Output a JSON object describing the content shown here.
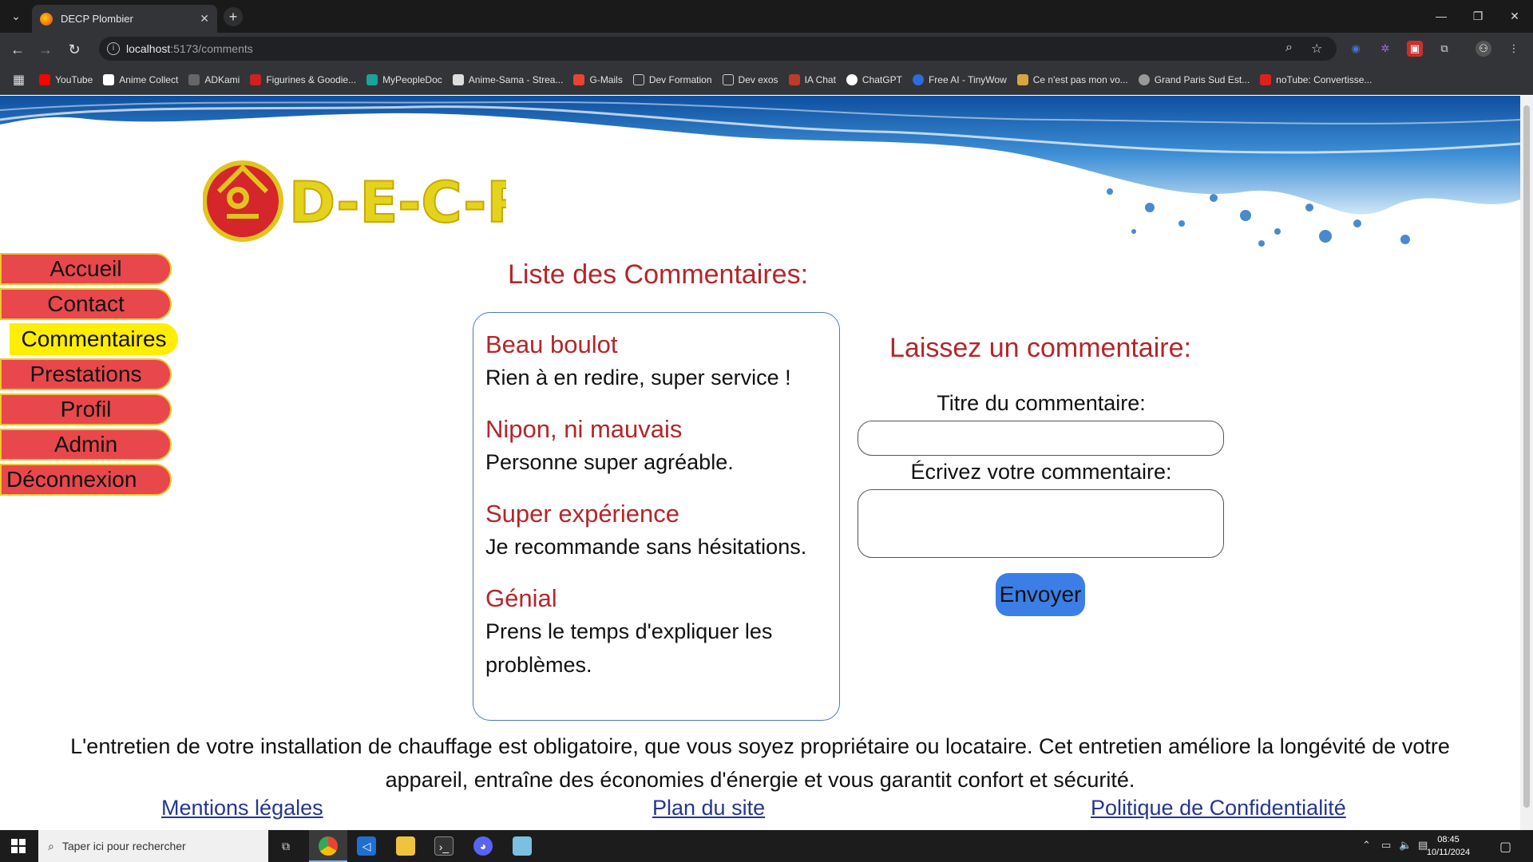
{
  "browser": {
    "tab_title": "DECP Plombier",
    "tab_close": "✕",
    "new_tab": "+",
    "url_host": "localhost",
    "url_path": ":5173/comments",
    "bookmarks": [
      {
        "label": "YouTube",
        "color": "#ff0000"
      },
      {
        "label": "Anime Collect",
        "color": "#ffffff"
      },
      {
        "label": "ADKami",
        "color": "#666666"
      },
      {
        "label": "Figurines & Goodie...",
        "color": "#d02020"
      },
      {
        "label": "MyPeopleDoc",
        "color": "#1aa39a"
      },
      {
        "label": "Anime-Sama - Strea...",
        "color": "#dddddd"
      },
      {
        "label": "G-Mails",
        "color": "#ea4335"
      },
      {
        "label": "Dev Formation",
        "color": "#888888"
      },
      {
        "label": "Dev exos",
        "color": "#888888"
      },
      {
        "label": "IA Chat",
        "color": "#c03a2b"
      },
      {
        "label": "ChatGPT",
        "color": "#ffffff"
      },
      {
        "label": "Free AI - TinyWow",
        "color": "#2d6cdf"
      },
      {
        "label": "Ce n'est pas mon vo...",
        "color": "#d9a441"
      },
      {
        "label": "Grand Paris Sud Est...",
        "color": "#999999"
      },
      {
        "label": "noTube: Convertisse...",
        "color": "#e02020"
      }
    ]
  },
  "site": {
    "logo_text": "D-E-C-P",
    "menu": [
      {
        "label": "Accueil",
        "active": false
      },
      {
        "label": "Contact",
        "active": false
      },
      {
        "label": "Commentaires",
        "active": true
      },
      {
        "label": "Prestations",
        "active": false
      },
      {
        "label": "Profil",
        "active": false
      },
      {
        "label": "Admin",
        "active": false
      },
      {
        "label": "Déconnexion",
        "active": false
      }
    ],
    "list_title": "Liste des Commentaires:",
    "comments": [
      {
        "title": "Beau boulot",
        "body": "Rien à en redire, super service !"
      },
      {
        "title": "Nipon, ni mauvais",
        "body": "Personne super agréable."
      },
      {
        "title": "Super expérience",
        "body": "Je recommande sans hésitations."
      },
      {
        "title": "Génial",
        "body": "Prens le temps d'expliquer les problèmes."
      }
    ],
    "form": {
      "title": "Laissez un commentaire:",
      "title_label": "Titre du commentaire:",
      "title_value": "",
      "comment_label": "Écrivez votre commentaire:",
      "comment_value": "",
      "submit": "Envoyer"
    },
    "footer": {
      "text": "L'entretien de votre installation de chauffage est obligatoire, que vous soyez propriétaire ou locataire. Cet entretien améliore la longévité de votre appareil, entraîne des économies d'énergie et vous garantit confort et sécurité.",
      "links": [
        "Mentions légales",
        "Plan du site",
        "Politique de Confidentialité"
      ]
    },
    "colors": {
      "menu_bg": "#e8474b",
      "menu_active": "#ffee00",
      "heading_red": "#b3262a",
      "button_blue": "#3b7fe6",
      "link_blue": "#25368f"
    }
  },
  "taskbar": {
    "search_placeholder": "Taper ici pour rechercher",
    "time": "08:45",
    "date": "10/11/2024"
  }
}
